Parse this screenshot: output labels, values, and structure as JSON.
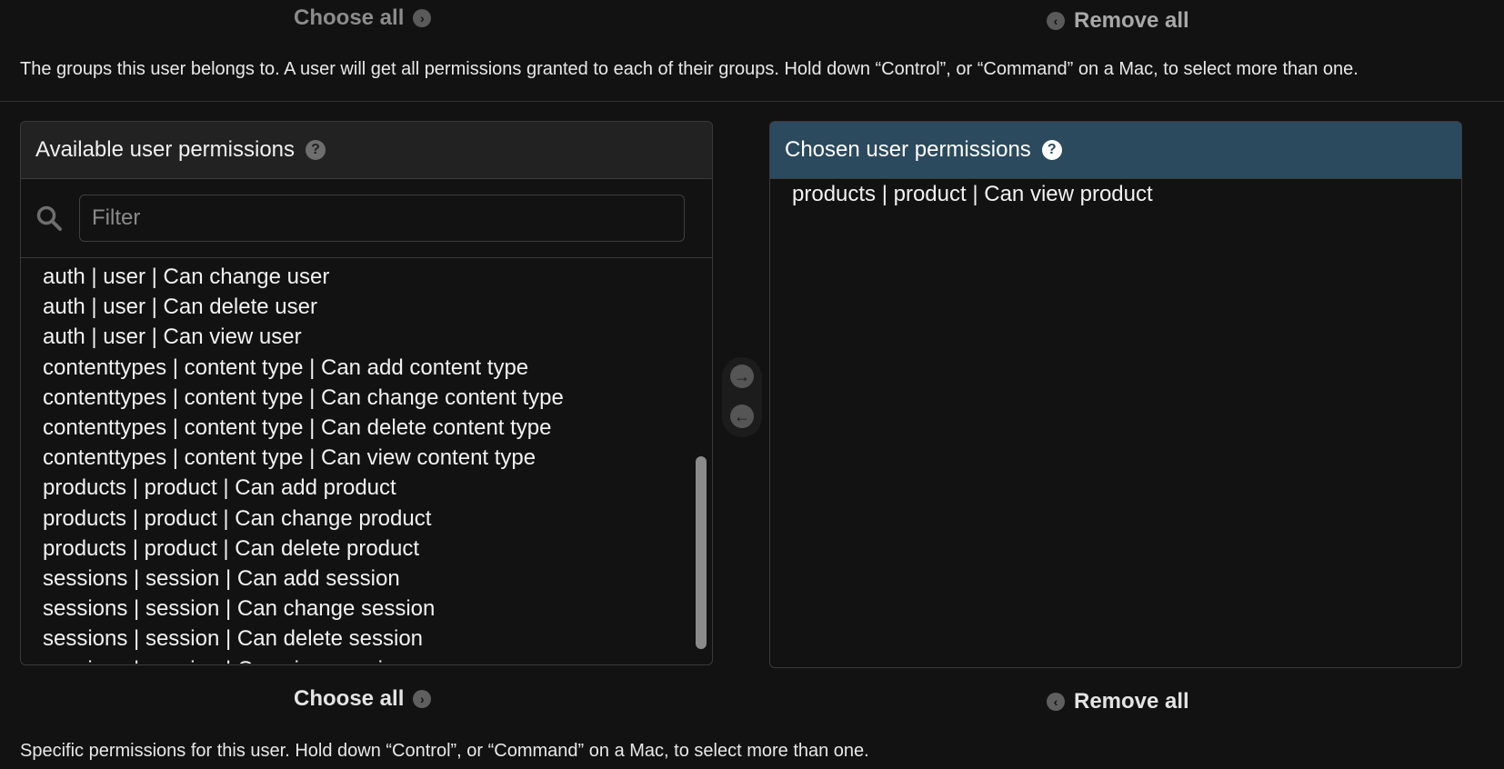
{
  "groups": {
    "choose_all_label": "Choose all",
    "remove_all_label": "Remove all",
    "help_text": "The groups this user belongs to. A user will get all permissions granted to each of their groups. Hold down “Control”, or “Command” on a Mac, to select more than one."
  },
  "permissions": {
    "available_title": "Available user permissions",
    "chosen_title": "Chosen user permissions",
    "filter_placeholder": "Filter",
    "available_items": [
      "auth | user | Can change user",
      "auth | user | Can delete user",
      "auth | user | Can view user",
      "contenttypes | content type | Can add content type",
      "contenttypes | content type | Can change content type",
      "contenttypes | content type | Can delete content type",
      "contenttypes | content type | Can view content type",
      "products | product | Can add product",
      "products | product | Can change product",
      "products | product | Can delete product",
      "sessions | session | Can add session",
      "sessions | session | Can change session",
      "sessions | session | Can delete session",
      "sessions | session | Can view session"
    ],
    "chosen_items": [
      "products | product | Can view product"
    ],
    "choose_all_label": "Choose all",
    "remove_all_label": "Remove all",
    "help_text": "Specific permissions for this user. Hold down “Control”, or “Command” on a Mac, to select more than one."
  },
  "icons": {
    "choose_arrow": "chevron-right-circle-icon",
    "remove_arrow": "chevron-left-circle-icon",
    "help": "question-circle-icon",
    "search": "search-icon",
    "move_right": "arrow-right-circle-icon",
    "move_left": "arrow-left-circle-icon"
  },
  "colors": {
    "background": "#121212",
    "chosen_header": "#2c4a5e",
    "available_header": "#222222",
    "border": "#3a3a3a"
  }
}
